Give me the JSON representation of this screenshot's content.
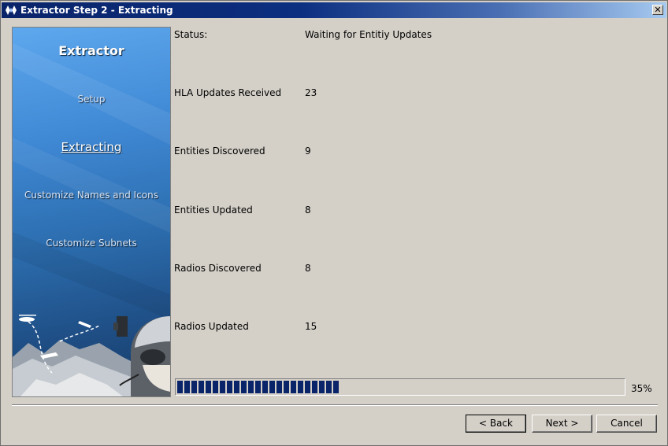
{
  "window": {
    "title": "Extractor Step 2 - Extracting",
    "close_label": "✕"
  },
  "sidebar": {
    "title": "Extractor",
    "steps": [
      {
        "label": "Setup",
        "active": false
      },
      {
        "label": "Extracting",
        "active": true
      },
      {
        "label": "Customize Names and Icons",
        "active": false
      },
      {
        "label": "Customize Subnets",
        "active": false
      }
    ]
  },
  "fields": [
    {
      "label": "Status:",
      "value": "Waiting for Entitiy Updates"
    },
    {
      "label": "HLA Updates Received",
      "value": "23"
    },
    {
      "label": "Entities Discovered",
      "value": "9"
    },
    {
      "label": "Entities Updated",
      "value": "8"
    },
    {
      "label": "Radios Discovered",
      "value": "8"
    },
    {
      "label": "Radios Updated",
      "value": "15"
    }
  ],
  "progress": {
    "fraction": 0.35,
    "text": "35%",
    "color": "#0a246a"
  },
  "buttons": {
    "back": "< Back",
    "next": "Next >",
    "cancel": "Cancel"
  }
}
